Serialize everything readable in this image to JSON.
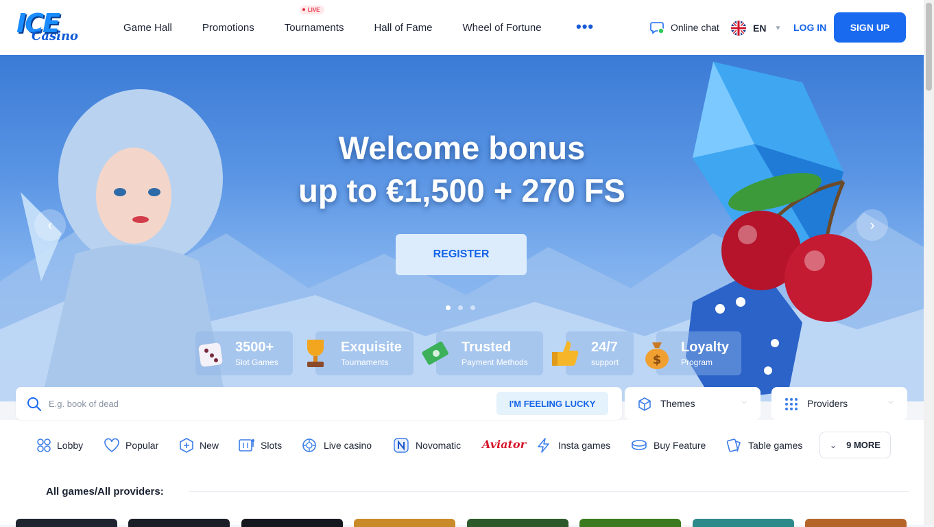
{
  "brand": {
    "logo_top": "ICE",
    "logo_bottom": "Casino"
  },
  "nav": {
    "items": [
      "Game Hall",
      "Promotions",
      "Tournaments",
      "Hall of Fame",
      "Wheel of Fortune"
    ],
    "live_badge": "LIVE",
    "more": "•••"
  },
  "header": {
    "chat_label": "Online chat",
    "language": "EN",
    "login_label": "LOG IN",
    "signup_label": "SIGN UP"
  },
  "hero": {
    "title_line1": "Welcome bonus",
    "title_line2": "up to €1,500 + 270 FS",
    "cta_label": "REGISTER",
    "slide_count": 3,
    "active_slide": 1,
    "features": [
      {
        "big": "3500+",
        "small": "Slot Games",
        "icon": "dice-icon"
      },
      {
        "big": "Exquisite",
        "small": "Tournaments",
        "icon": "trophy-icon"
      },
      {
        "big": "Trusted",
        "small": "Payment Methods",
        "icon": "money-icon"
      },
      {
        "big": "24/7",
        "small": "support",
        "icon": "thumbs-up-icon"
      },
      {
        "big": "Loyalty",
        "small": "Program",
        "icon": "money-bag-icon"
      }
    ]
  },
  "search": {
    "placeholder": "E.g. book of dead",
    "lucky_label": "I'M FEELING LUCKY",
    "themes_label": "Themes",
    "providers_label": "Providers"
  },
  "categories": {
    "items": [
      "Lobby",
      "Popular",
      "New",
      "Slots",
      "Live casino",
      "Novomatic",
      "Aviator",
      "Insta games",
      "Buy Feature",
      "Table games"
    ],
    "more_label": "9 MORE"
  },
  "section": {
    "title": "All games/All providers:"
  },
  "colors": {
    "accent": "#1a6af0",
    "live": "#e23445",
    "aviator": "#d6162b"
  }
}
